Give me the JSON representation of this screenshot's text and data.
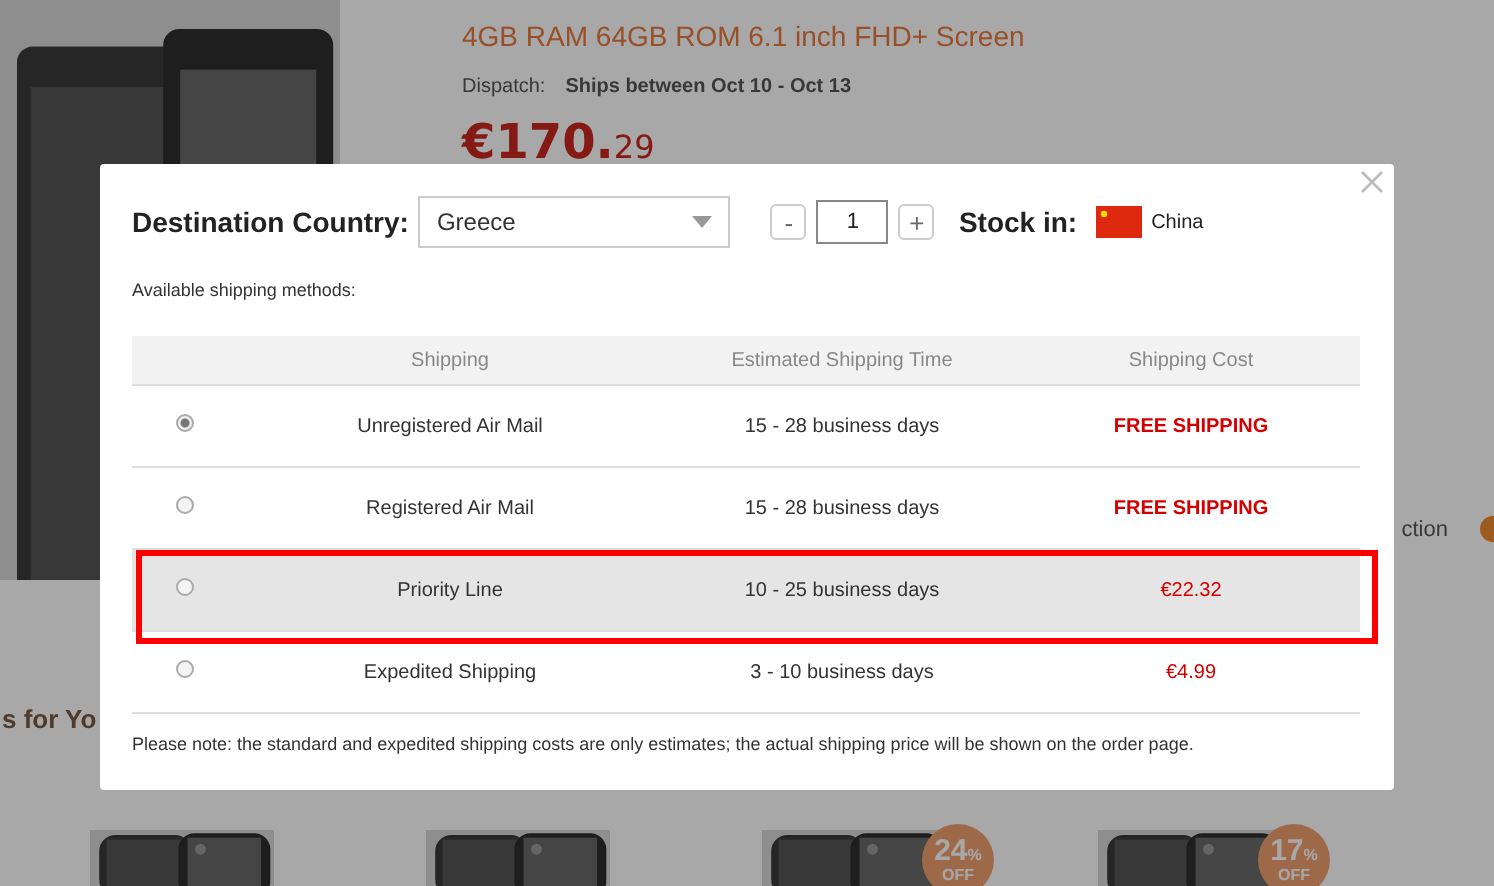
{
  "product_page": {
    "title": "4GB RAM 64GB ROM 6.1 inch FHD+ Screen",
    "dispatch_label": "Dispatch:",
    "dispatch_value": "Ships between Oct 10 - Oct 13",
    "price_whole": "€170.",
    "price_cents": "29",
    "side_text": "ction",
    "section_heading": "s for Yo",
    "products": [
      {
        "kind": "picture"
      },
      {
        "kind": "picture"
      },
      {
        "kind": "picture",
        "badge": {
          "percent": "24",
          "unit": "%",
          "off": "OFF"
        }
      },
      {
        "kind": "picture",
        "badge": {
          "percent": "17",
          "unit": "%",
          "off": "OFF"
        }
      }
    ]
  },
  "shipping_dialog": {
    "destination_label": "Destination Country:",
    "destination_value": "Greece",
    "quantity": "1",
    "minus": "-",
    "plus": "+",
    "stock_label": "Stock in:",
    "stock_value": "China",
    "methods_label": "Available shipping methods:",
    "columns": [
      "Shipping",
      "Estimated Shipping Time",
      "Shipping Cost"
    ],
    "rows": [
      {
        "method": "Unregistered Air Mail",
        "time": "15 - 28 business days",
        "cost": "FREE SHIPPING",
        "kind": "free",
        "selected": true,
        "highlighted": false
      },
      {
        "method": "Registered Air Mail",
        "time": "15 - 28 business days",
        "cost": "FREE SHIPPING",
        "kind": "free",
        "selected": false,
        "highlighted": false
      },
      {
        "method": "Priority Line",
        "time": "10 - 25 business days",
        "cost": "€22.32",
        "kind": "price",
        "selected": false,
        "highlighted": true
      },
      {
        "method": "Expedited Shipping",
        "time": "3 - 10 business days",
        "cost": "€4.99",
        "kind": "price",
        "selected": false,
        "highlighted": false
      }
    ],
    "note": "Please note: the standard and expedited shipping costs are only estimates; the actual shipping price will be shown on the order page."
  }
}
